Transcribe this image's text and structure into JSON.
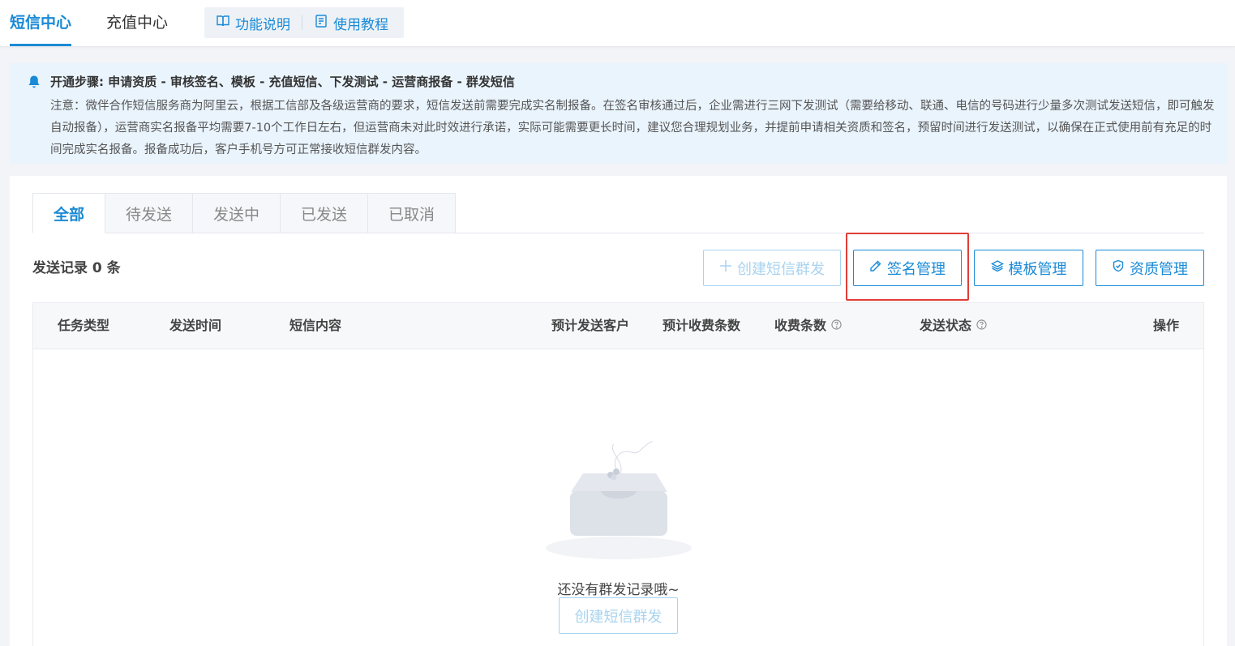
{
  "header": {
    "tabs": [
      {
        "label": "短信中心",
        "active": true
      },
      {
        "label": "充值中心",
        "active": false
      }
    ],
    "help_links": [
      {
        "label": "功能说明",
        "icon": "book-icon"
      },
      {
        "label": "使用教程",
        "icon": "document-icon"
      }
    ]
  },
  "notice": {
    "icon": "bell-icon",
    "title": "开通步骤: 申请资质 - 审核签名、模板 - 充值短信、下发测试 - 运营商报备 - 群发短信",
    "body": "注意：微伴合作短信服务商为阿里云，根据工信部及各级运营商的要求，短信发送前需要完成实名制报备。在签名审核通过后，企业需进行三网下发测试（需要给移动、联通、电信的号码进行少量多次测试发送短信，即可触发自动报备），运营商实名报备平均需要7-10个工作日左右，但运营商未对此时效进行承诺，实际可能需要更长时间，建议您合理规划业务，并提前申请相关资质和签名，预留时间进行发送测试，以确保在正式使用前有充足的时间完成实名报备。报备成功后，客户手机号方可正常接收短信群发内容。"
  },
  "tabs": [
    {
      "label": "全部",
      "active": true
    },
    {
      "label": "待发送",
      "active": false
    },
    {
      "label": "发送中",
      "active": false
    },
    {
      "label": "已发送",
      "active": false
    },
    {
      "label": "已取消",
      "active": false
    }
  ],
  "record_count": "发送记录 0 条",
  "actions": {
    "create": "创建短信群发",
    "signature": "签名管理",
    "template": "模板管理",
    "qualification": "资质管理"
  },
  "table": {
    "columns": {
      "task_type": "任务类型",
      "send_time": "发送时间",
      "content": "短信内容",
      "est_customers": "预计发送客户",
      "est_charge": "预计收费条数",
      "charge": "收费条数",
      "status": "发送状态",
      "ops": "操作"
    }
  },
  "empty": {
    "text": "还没有群发记录哦~",
    "button": "创建短信群发"
  },
  "colors": {
    "accent": "#1a8ad6",
    "disabled": "#a9d3ef",
    "highlight": "#e03d36",
    "notice_bg": "#eaf4fd"
  }
}
